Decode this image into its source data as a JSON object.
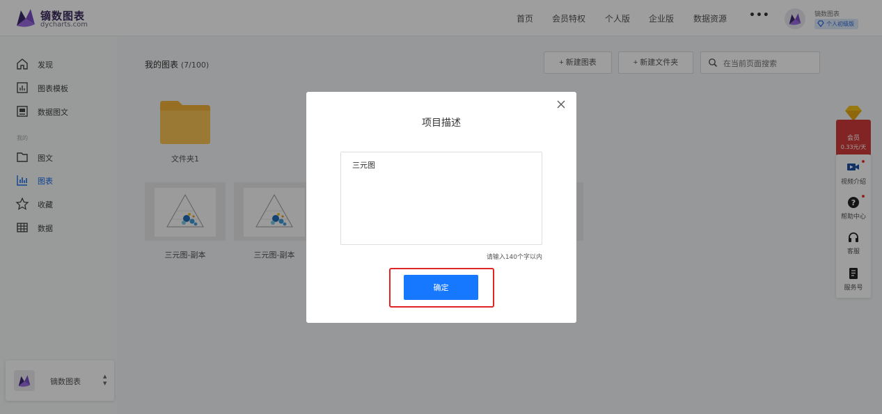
{
  "brand": {
    "name": "镝数图表",
    "domain": "dycharts.com",
    "accent": "#1677ff",
    "logo_icon": "butterfly-logo-icon"
  },
  "header": {
    "nav": [
      "首页",
      "会员特权",
      "个人版",
      "企业版",
      "数据资源"
    ],
    "more": "•••",
    "user_name": "镝数图表",
    "user_badge": "个人初级版"
  },
  "sidebar": {
    "items": [
      {
        "label": "发现",
        "icon": "home-icon"
      },
      {
        "label": "图表模板",
        "icon": "chart-template-icon"
      },
      {
        "label": "数据图文",
        "icon": "data-article-icon"
      }
    ],
    "section_label": "我的",
    "my_items": [
      {
        "label": "图文",
        "icon": "article-icon"
      },
      {
        "label": "图表",
        "icon": "bar-chart-icon",
        "active": true
      },
      {
        "label": "收藏",
        "icon": "star-icon"
      },
      {
        "label": "数据",
        "icon": "table-icon"
      }
    ],
    "account_name": "镝数图表"
  },
  "main": {
    "title": "我的图表",
    "count": "(7/100)",
    "new_chart_label": "+ 新建图表",
    "new_folder_label": "+ 新建文件夹",
    "search_placeholder": "在当前页面搜索",
    "folder_name": "文件夹1",
    "charts": [
      {
        "name": "三元图-副本"
      },
      {
        "name": "三元图-副本"
      }
    ]
  },
  "float_bar": {
    "vip_title": "会员",
    "vip_price": "0.33元/天",
    "items": [
      {
        "label": "视频介绍",
        "icon": "video-icon"
      },
      {
        "label": "帮助中心",
        "icon": "help-icon"
      },
      {
        "label": "客服",
        "icon": "headset-icon"
      },
      {
        "label": "服务号",
        "icon": "service-account-icon"
      }
    ]
  },
  "modal": {
    "title": "项目描述",
    "textarea_value": "三元图",
    "hint": "请输入140个字以内",
    "confirm_label": "确定"
  }
}
